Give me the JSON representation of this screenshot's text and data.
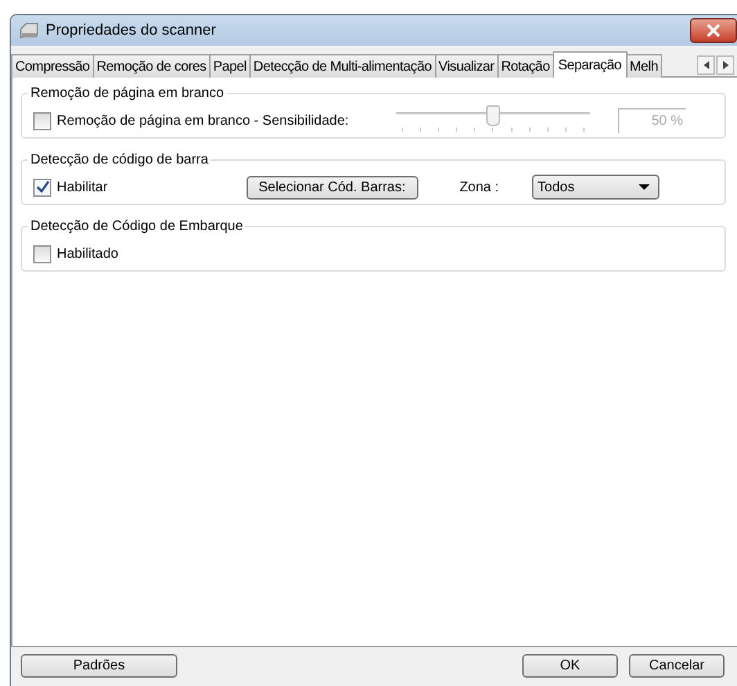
{
  "window": {
    "title": "Propriedades do scanner"
  },
  "tabs": [
    {
      "label": "Compressão",
      "selected": false
    },
    {
      "label": "Remoção de cores",
      "selected": false
    },
    {
      "label": "Papel",
      "selected": false
    },
    {
      "label": "Detecção de Multi-alimentação",
      "selected": false
    },
    {
      "label": "Visualizar",
      "selected": false
    },
    {
      "label": "Rotação",
      "selected": false
    },
    {
      "label": "Separação",
      "selected": true
    },
    {
      "label": "Melh",
      "selected": false
    }
  ],
  "groups": [
    {
      "title": "Remoção de página em branco",
      "kind": "slider",
      "checkbox": {
        "label": "Remoção de página em branco - Sensibilidade:",
        "checked": false
      },
      "slider": {
        "level": 0.49,
        "disabled": true
      },
      "reading": "50 %"
    },
    {
      "title": "Detecção de código de barra",
      "kind": "barcode",
      "checkbox": {
        "label": "Habilitar",
        "checked": true
      },
      "button": "Selecionar Cód. Barras:",
      "zone_label": "Zona :",
      "zone_value": "Todos"
    },
    {
      "title": "Detecção de Código de Embarque",
      "kind": "plain",
      "checkbox": {
        "label": "Habilitado",
        "checked": false
      }
    }
  ],
  "footer": {
    "left_button": "Padrões",
    "buttons": [
      "OK",
      "Cancelar"
    ]
  }
}
